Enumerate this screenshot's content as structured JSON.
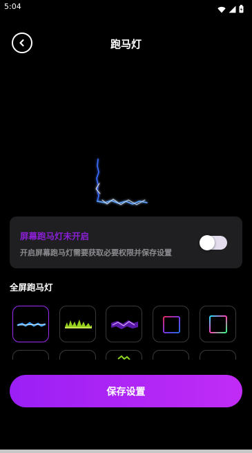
{
  "status_bar": {
    "time": "5:04",
    "icons": [
      "wifi-icon",
      "signal-icon",
      "battery-icon"
    ]
  },
  "header": {
    "title": "跑马灯",
    "back_icon": "chevron-left-icon"
  },
  "status_card": {
    "title": "屏幕跑马灯未开启",
    "description": "开启屏幕跑马灯需要获取必要权限并保存设置",
    "toggle_on": false
  },
  "section": {
    "title": "全屏跑马灯"
  },
  "effects": [
    {
      "icon": "blue-lightning-icon",
      "selected": true
    },
    {
      "icon": "green-spectrum-icon",
      "selected": false
    },
    {
      "icon": "purple-lightning-icon",
      "selected": false
    },
    {
      "icon": "neon-gradient-frame-icon",
      "selected": false
    },
    {
      "icon": "neon-gradient-frame-icon",
      "selected": false
    },
    {
      "icon": "effect-icon",
      "selected": false
    },
    {
      "icon": "effect-icon",
      "selected": false
    },
    {
      "icon": "green-sparkle-icon",
      "selected": false
    },
    {
      "icon": "effect-icon",
      "selected": false
    },
    {
      "icon": "effect-icon",
      "selected": false
    }
  ],
  "save_button": {
    "label": "保存设置"
  },
  "colors": {
    "accent": "#9b1ff5",
    "card_title": "#8a1fd6",
    "card_bg": "#1f1f21",
    "background": "#000000"
  }
}
